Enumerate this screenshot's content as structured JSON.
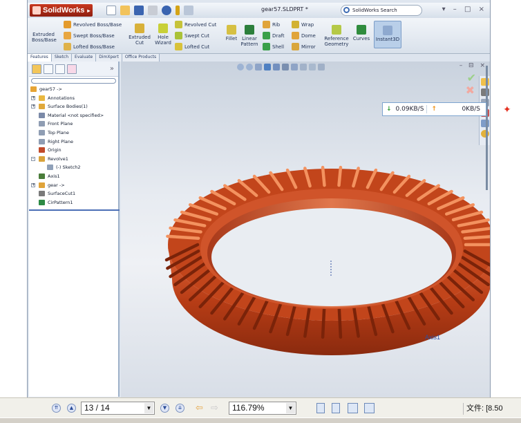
{
  "app": {
    "brand": "SolidWorks",
    "document_title": "gear57.SLDPRT *",
    "search_placeholder": "SolidWorks Search",
    "help": "?",
    "window_controls": "▾ – □ ×"
  },
  "command_manager": {
    "extruded_boss": "Extruded Boss/Base",
    "revolved_boss": "Revolved Boss/Base",
    "swept_boss": "Swept Boss/Base",
    "lofted_boss": "Lofted Boss/Base",
    "extruded_cut": "Extruded Cut",
    "hole_wizard": "Hole Wizard",
    "revolved_cut": "Revolved Cut",
    "swept_cut": "Swept Cut",
    "lofted_cut": "Lofted Cut",
    "fillet": "Fillet",
    "linear_pattern": "Linear Pattern",
    "rib": "Rib",
    "draft": "Draft",
    "shell": "Shell",
    "wrap": "Wrap",
    "dome": "Dome",
    "mirror": "Mirror",
    "reference_geometry": "Reference Geometry",
    "curves": "Curves",
    "instant3d": "Instant3D"
  },
  "tabs": [
    "Features",
    "Sketch",
    "Evaluate",
    "DimXpert",
    "Office Products"
  ],
  "feature_tree": [
    {
      "label": "gear57 ->",
      "icon": "part-icon",
      "indent": 0
    },
    {
      "label": "Annotations",
      "icon": "annotations-icon",
      "indent": 1,
      "expander": "+"
    },
    {
      "label": "Surface Bodies(1)",
      "icon": "surface-bodies-icon",
      "indent": 1,
      "expander": "+"
    },
    {
      "label": "Material <not specified>",
      "icon": "material-icon",
      "indent": 1
    },
    {
      "label": "Front Plane",
      "icon": "plane-icon",
      "indent": 1
    },
    {
      "label": "Top Plane",
      "icon": "plane-icon",
      "indent": 1
    },
    {
      "label": "Right Plane",
      "icon": "plane-icon",
      "indent": 1
    },
    {
      "label": "Origin",
      "icon": "origin-icon",
      "indent": 1
    },
    {
      "label": "Revolve1",
      "icon": "revolve-icon",
      "indent": 1,
      "expander": "–"
    },
    {
      "label": "(-) Sketch2",
      "icon": "sketch-icon",
      "indent": 2
    },
    {
      "label": "Axis1",
      "icon": "axis-icon",
      "indent": 1
    },
    {
      "label": "gear ->",
      "icon": "gear-icon",
      "indent": 1,
      "expander": "+"
    },
    {
      "label": "SurfaceCut1",
      "icon": "surface-cut-icon",
      "indent": 1
    },
    {
      "label": "CirPattern1",
      "icon": "circular-pattern-icon",
      "indent": 1
    }
  ],
  "viewport": {
    "axis_label": "Axis1",
    "gear_color": "#c2451b"
  },
  "network_speed": {
    "download": "0.09KB/S",
    "upload": "0KB/S"
  },
  "pdf_toolbar": {
    "page": "13 / 14",
    "zoom": "116.79%",
    "file_label": "文件: [8.50"
  }
}
